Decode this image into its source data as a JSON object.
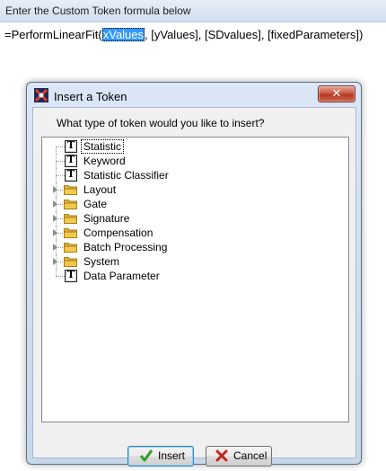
{
  "header": {
    "title": "Enter the Custom Token formula below"
  },
  "formula": {
    "prefix": "=PerformLinearFit(",
    "selected": "xValues",
    "suffix": ", [yValues], [SDvalues], [fixedParameters])"
  },
  "dialog": {
    "title": "Insert a Token",
    "close_label": "✕",
    "prompt": "What type of token would you like to insert?",
    "tree_items": [
      {
        "label": "Statistic",
        "icon": "token-t-icon",
        "expandable": false,
        "selected": true
      },
      {
        "label": "Keyword",
        "icon": "token-t-icon",
        "expandable": false
      },
      {
        "label": "Statistic Classifier",
        "icon": "token-t-icon",
        "expandable": false
      },
      {
        "label": "Layout",
        "icon": "folder-icon",
        "expandable": true
      },
      {
        "label": "Gate",
        "icon": "folder-icon",
        "expandable": true
      },
      {
        "label": "Signature",
        "icon": "folder-icon",
        "expandable": true
      },
      {
        "label": "Compensation",
        "icon": "folder-icon",
        "expandable": true
      },
      {
        "label": "Batch Processing",
        "icon": "folder-icon",
        "expandable": true
      },
      {
        "label": "System",
        "icon": "folder-icon",
        "expandable": true
      },
      {
        "label": "Data Parameter",
        "icon": "token-t-icon",
        "expandable": false
      }
    ],
    "insert_label": "Insert",
    "cancel_label": "Cancel"
  },
  "colors": {
    "selection": "#3399ff",
    "insert_check": "#2e9e2e",
    "cancel_x": "#c0281e",
    "folder": "#f2c94c"
  }
}
